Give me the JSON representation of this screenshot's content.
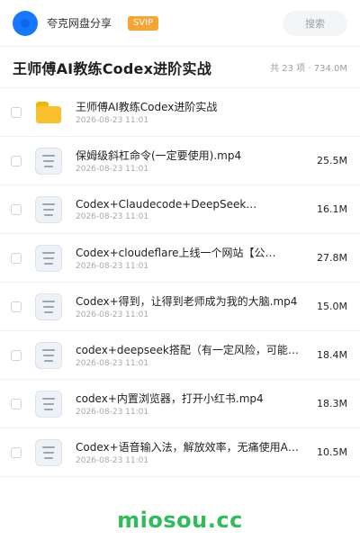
{
  "header": {
    "brand_name": "夸克网盘分享",
    "badge": "SVIP",
    "search_label": "搜索"
  },
  "share": {
    "title": "王师傅AI教练Codex进阶实战",
    "meta": "共 23 项 · 734.0M"
  },
  "items": [
    {
      "type": "folder",
      "name": "王师傅AI教练Codex进阶实战",
      "date": "2026-08-23 11:01",
      "size": ""
    },
    {
      "type": "file",
      "name": "保姆级斜杠命令(一定要使用).mp4",
      "date": "2026-08-23 11:01",
      "size": "25.5M"
    },
    {
      "type": "file",
      "name": "Codex+Claudecode+DeepSeek…",
      "date": "2026-08-23 11:01",
      "size": "16.1M"
    },
    {
      "type": "file",
      "name": "Codex+cloudeflare上线一个网站【公…",
      "date": "2026-08-23 11:01",
      "size": "27.8M"
    },
    {
      "type": "file",
      "name": "Codex+得到，让得到老师成为我的大脑.mp4",
      "date": "2026-08-23 11:01",
      "size": "15.0M"
    },
    {
      "type": "file",
      "name": "codex+deepseek搭配（有一定风险，可能…",
      "date": "2026-08-23 11:01",
      "size": "18.4M"
    },
    {
      "type": "file",
      "name": "codex+内置浏览器，打开小红书.mp4",
      "date": "2026-08-23 11:01",
      "size": "18.3M"
    },
    {
      "type": "file",
      "name": "Codex+语音输入法，解放效率，无痛使用AI.m…",
      "date": "2026-08-23 11:01",
      "size": "10.5M"
    }
  ],
  "footer": {
    "watermark": "miosou.cc"
  },
  "icons": {
    "folder": "folder-icon",
    "file": "file-icon",
    "checkbox": "checkbox-icon"
  }
}
